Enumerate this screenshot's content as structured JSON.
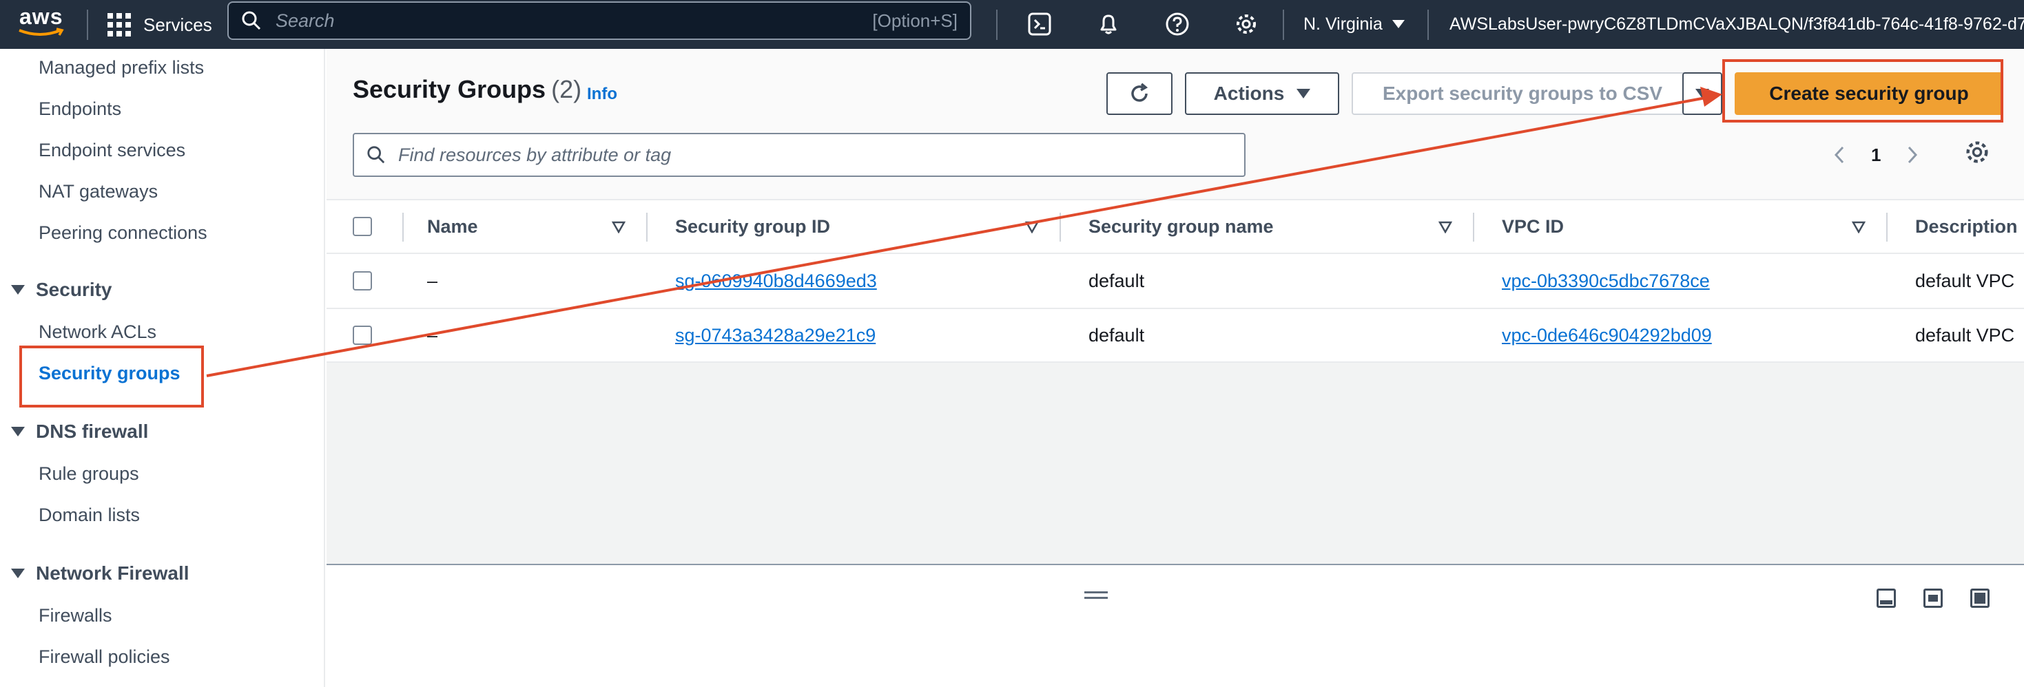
{
  "topnav": {
    "logo_text": "aws",
    "services_label": "Services",
    "search_placeholder": "Search",
    "search_shortcut": "[Option+S]",
    "region_label": "N. Virginia",
    "account_label": "AWSLabsUser-pwryC6Z8TLDmCVaXJBALQN/f3f841db-764c-41f8-9762-d7"
  },
  "sidebar": {
    "items_top": [
      {
        "label": "Managed prefix lists"
      },
      {
        "label": "Endpoints"
      },
      {
        "label": "Endpoint services"
      },
      {
        "label": "NAT gateways"
      },
      {
        "label": "Peering connections"
      }
    ],
    "security": {
      "label": "Security",
      "items": [
        {
          "label": "Network ACLs"
        },
        {
          "label": "Security groups"
        }
      ]
    },
    "dns_firewall": {
      "label": "DNS firewall",
      "items": [
        {
          "label": "Rule groups"
        },
        {
          "label": "Domain lists"
        }
      ]
    },
    "network_firewall": {
      "label": "Network Firewall",
      "items": [
        {
          "label": "Firewalls"
        },
        {
          "label": "Firewall policies"
        }
      ]
    }
  },
  "main": {
    "title": "Security Groups",
    "count": "(2)",
    "info_label": "Info",
    "actions_label": "Actions",
    "export_label": "Export security groups to CSV",
    "create_label": "Create security group",
    "filter_placeholder": "Find resources by attribute or tag",
    "page_number": "1",
    "columns": [
      "Name",
      "Security group ID",
      "Security group name",
      "VPC ID",
      "Description"
    ],
    "rows": [
      {
        "name": "–",
        "sg_id": "sg-0609940b8d4669ed3",
        "sg_name": "default",
        "vpc_id": "vpc-0b3390c5dbc7678ce",
        "description": "default VPC"
      },
      {
        "name": "–",
        "sg_id": "sg-0743a3428a29e21c9",
        "sg_name": "default",
        "vpc_id": "vpc-0de646c904292bd09",
        "description": "default VPC"
      }
    ]
  },
  "colors": {
    "nav_bg": "#232f3e",
    "link": "#0972d3",
    "primary_button": "#f0a032",
    "annotation": "#e04a2c"
  },
  "icons": [
    "services-grid-icon",
    "search-icon",
    "cloudshell-icon",
    "notifications-icon",
    "help-icon",
    "settings-icon",
    "refresh-icon",
    "caret-down-icon",
    "chevron-left-icon",
    "chevron-right-icon",
    "gear-icon",
    "sort-icon",
    "drag-handle-icon"
  ]
}
